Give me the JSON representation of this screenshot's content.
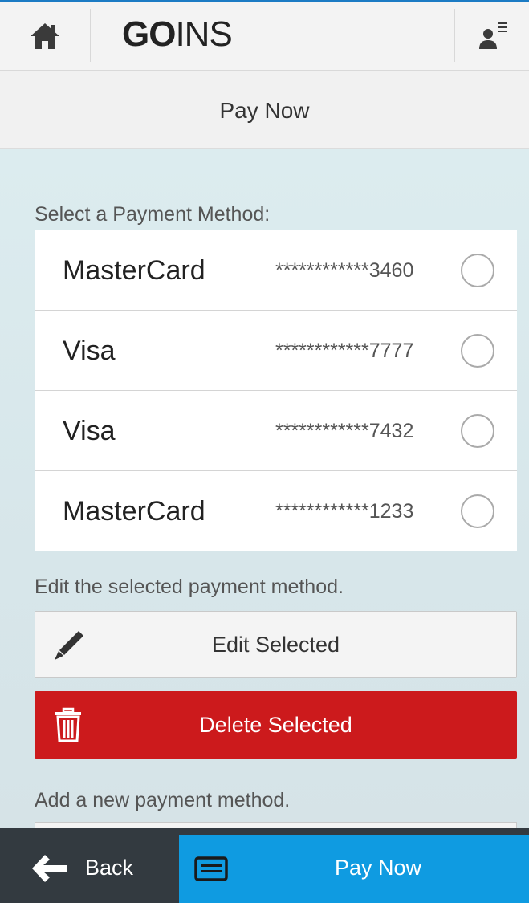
{
  "header": {
    "logo_bold": "GO",
    "logo_rest": "INS",
    "home_icon": "home-icon",
    "user_menu_icon": "user-menu-icon"
  },
  "title": "Pay Now",
  "payment": {
    "select_label": "Select a Payment Method:",
    "methods": [
      {
        "name": "MasterCard",
        "number": "************3460"
      },
      {
        "name": "Visa",
        "number": "************7777"
      },
      {
        "name": "Visa",
        "number": "************7432"
      },
      {
        "name": "MasterCard",
        "number": "************1233"
      }
    ],
    "edit_hint": "Edit the selected payment method.",
    "edit_button": "Edit Selected",
    "delete_button": "Delete Selected",
    "add_hint": "Add a new payment method."
  },
  "footer": {
    "back_label": "Back",
    "pay_label": "Pay Now"
  },
  "colors": {
    "accent_blue": "#0f9be1",
    "delete_red": "#cc1a1c",
    "footer_dark": "#333a40"
  }
}
